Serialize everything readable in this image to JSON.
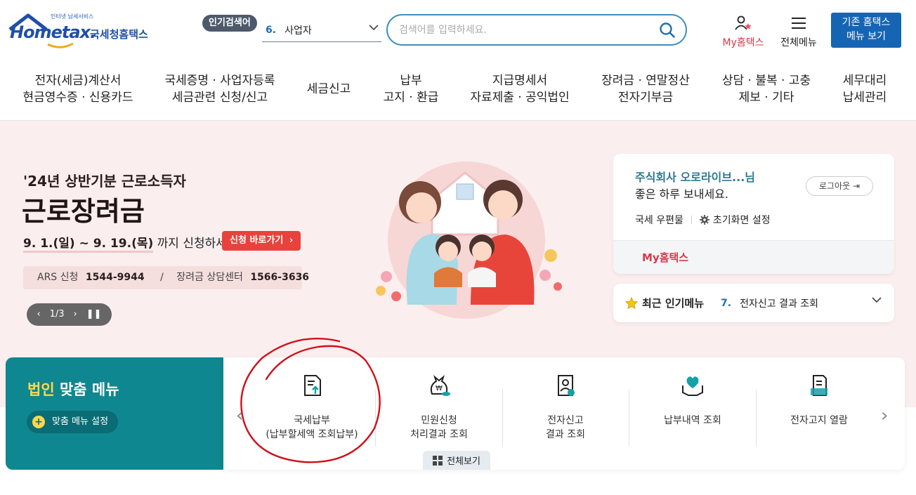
{
  "header": {
    "logo_tagline": "인터넷 납세서비스",
    "logo_word": "Hometax.",
    "logo_korean": "국세청홈택스",
    "popular_label": "인기검색어",
    "popular_num": "6.",
    "popular_term": "사업자",
    "search_placeholder": "검색어를 입력하세요.",
    "my_label": "My홈택스",
    "allmenu_label": "전체메뉴",
    "classic_line1": "기존 홈택스",
    "classic_line2": "메뉴 보기"
  },
  "gnb": [
    {
      "l1": "전자(세금)계산서",
      "l2": "현금영수증 · 신용카드"
    },
    {
      "l1": "국세증명 · 사업자등록",
      "l2": "세금관련 신청/신고"
    },
    {
      "l1": "세금신고",
      "l2": ""
    },
    {
      "l1": "납부",
      "l2": "고지 · 환급"
    },
    {
      "l1": "지급명세서",
      "l2": "자료제출 · 공익법인"
    },
    {
      "l1": "장려금 · 연말정산",
      "l2": "전자기부금"
    },
    {
      "l1": "상담 · 불복 · 고충",
      "l2": "제보 · 기타"
    },
    {
      "l1": "세무대리",
      "l2": "납세관리"
    }
  ],
  "hero": {
    "subtitle": "'24년 상반기분 근로소득자",
    "title": "근로장려금",
    "date": "9. 1.(일) ~ 9. 19.(목)",
    "date_suffix": " 까지 신청하세요!",
    "cta": "신청 바로가기",
    "ars_label": "ARS 신청",
    "ars_num": "1544-9944",
    "ars_sep": "/",
    "center_label": "장려금 상담센터",
    "center_num": "1566-3636",
    "pager": "1/3"
  },
  "login": {
    "user": "주식회사 오로라이브...",
    "user_suffix": "님",
    "greeting": "좋은 하루 보내세요.",
    "logout": "로그아웃",
    "mailbox": "국세 우편물",
    "init_setting": "초기화면 설정",
    "my_tab": "My홈택스"
  },
  "recent": {
    "title": "최근 인기메뉴",
    "num": "7.",
    "item": "전자신고 결과 조회"
  },
  "custom_menu": {
    "title_highlight": "법인",
    "title_rest": " 맞춤 메뉴",
    "setting": "맞춤 메뉴 설정",
    "items": [
      {
        "l1": "국세납부",
        "l2": "(납부할세액 조회납부)"
      },
      {
        "l1": "민원신청",
        "l2": "처리결과 조회"
      },
      {
        "l1": "전자신고",
        "l2": "결과 조회"
      },
      {
        "l1": "납부내역 조회",
        "l2": ""
      },
      {
        "l1": "전자고지 열람",
        "l2": ""
      }
    ],
    "view_all": "전체보기"
  },
  "colors": {
    "brand_blue": "#1665b5",
    "teal": "#0f8790",
    "accent_red": "#e8423c",
    "annotation": "#d0101a"
  }
}
